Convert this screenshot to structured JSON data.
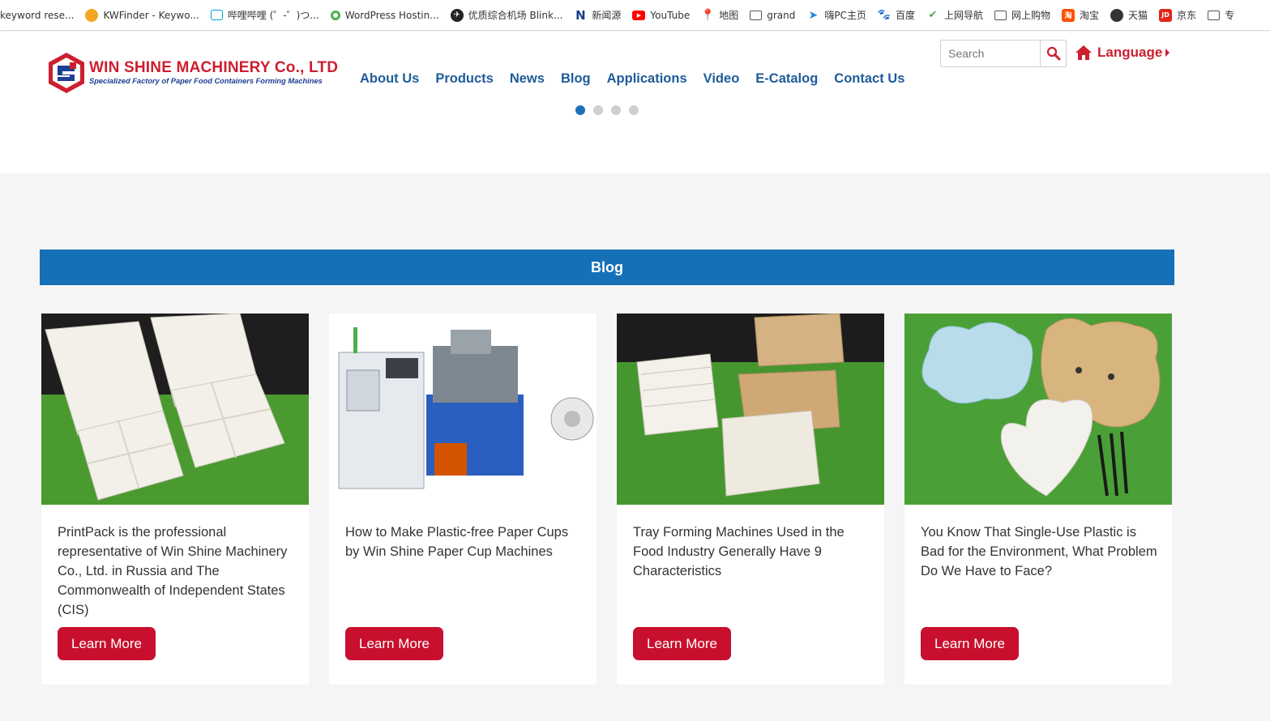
{
  "bookmarks": [
    {
      "label": "keyword rese...",
      "icon": "none",
      "color": "#ffffff"
    },
    {
      "label": "KWFinder - Keywo...",
      "icon": "kwfinder-icon",
      "color": "#f5a623"
    },
    {
      "label": "哔哩哔哩 (゜-゜)つ...",
      "icon": "bilibili-icon",
      "color": "#00a1d6"
    },
    {
      "label": "WordPress Hostin...",
      "icon": "wordpress-host-icon",
      "color": "#4caf50"
    },
    {
      "label": "优质综合机场 Blink...",
      "icon": "blink-icon",
      "color": "#222222"
    },
    {
      "label": "新闻源",
      "icon": "news-n-icon",
      "color": "#1a3f8b"
    },
    {
      "label": "YouTube",
      "icon": "youtube-icon",
      "color": "#ff0000"
    },
    {
      "label": "地图",
      "icon": "maps-icon",
      "color": "#34a853"
    },
    {
      "label": "grand",
      "icon": "folder-icon",
      "color": "#555555"
    },
    {
      "label": "嗨PC主页",
      "icon": "hipc-icon",
      "color": "#1e88e5"
    },
    {
      "label": "百度",
      "icon": "baidu-icon",
      "color": "#2932e1"
    },
    {
      "label": "上网导航",
      "icon": "hao123-icon",
      "color": "#4caf50"
    },
    {
      "label": "网上购物",
      "icon": "folder-icon",
      "color": "#555555"
    },
    {
      "label": "淘宝",
      "icon": "taobao-icon",
      "color": "#ff5000"
    },
    {
      "label": "天猫",
      "icon": "globe-icon",
      "color": "#333333"
    },
    {
      "label": "京东",
      "icon": "jd-icon",
      "color": "#e1251b"
    },
    {
      "label": "专",
      "icon": "folder-icon",
      "color": "#555555"
    }
  ],
  "header": {
    "logo_title": "WIN SHINE MACHINERY Co., LTD",
    "logo_subtitle": "Specialized Factory of Paper Food Containers Forming Machines",
    "nav": [
      "About Us",
      "Products",
      "News",
      "Blog",
      "Applications",
      "Video",
      "E-Catalog",
      "Contact Us"
    ],
    "search_placeholder": "Search",
    "language_label": "Language"
  },
  "slider": {
    "dot_count": 4,
    "active_index": 0
  },
  "blog": {
    "section_title": "Blog",
    "cards": [
      {
        "title": "PrintPack is the professional representative of Win Shine Machinery Co., Ltd. in Russia and The Commonwealth of Independent States (CIS)",
        "button": "Learn More",
        "image": "white-compartment-trays-on-grass"
      },
      {
        "title": "How to Make Plastic-free Paper Cups by Win Shine Paper Cup Machines",
        "button": "Learn More",
        "image": "paper-cup-machine"
      },
      {
        "title": "Tray Forming Machines Used in the Food Industry Generally Have 9 Characteristics",
        "button": "Learn More",
        "image": "paper-trays-on-grass"
      },
      {
        "title": "You Know That Single-Use Plastic is Bad for the Environment, What Problem Do We Have to Face?",
        "button": "Learn More",
        "image": "shaped-plates-on-grass"
      }
    ]
  },
  "colors": {
    "nav_blue": "#1f5c99",
    "brand_red": "#cc1f2f",
    "button_red": "#c8102e",
    "bar_blue": "#1570b8"
  }
}
